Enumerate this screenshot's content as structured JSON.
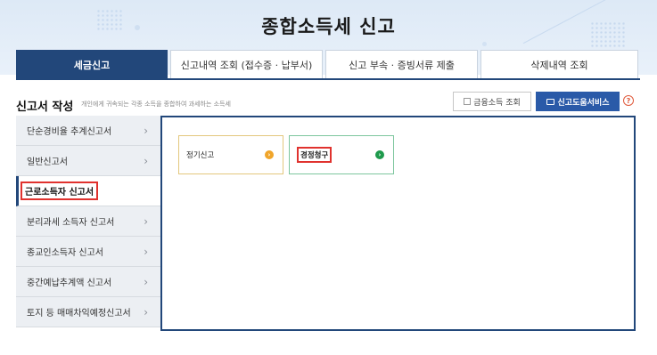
{
  "header": {
    "title": "종합소득세 신고"
  },
  "tabs": [
    {
      "label": "세금신고",
      "active": true
    },
    {
      "label": "신고내역 조회 (접수증 · 납부서)",
      "active": false
    },
    {
      "label": "신고 부속 · 증빙서류 제출",
      "active": false
    },
    {
      "label": "삭제내역 조회",
      "active": false
    }
  ],
  "section": {
    "title": "신고서 작성",
    "description": "개인에게 귀속되는 각종 소득을 종합하여 과세하는 소득세"
  },
  "actions": {
    "finance_label": "금융소득 조회",
    "help_label": "신고도움서비스",
    "help_question": "?"
  },
  "sidebar": {
    "items": [
      {
        "label": "단순경비율 추계신고서"
      },
      {
        "label": "일반신고서"
      },
      {
        "label": "근로소득자 신고서",
        "active": true
      },
      {
        "label": "분리과세 소득자 신고서"
      },
      {
        "label": "종교인소득자 신고서"
      },
      {
        "label": "중간예납추계액 신고서"
      },
      {
        "label": "토지 등 매매차익예정신고서"
      }
    ],
    "chevron": "›"
  },
  "cards": [
    {
      "label": "정기신고",
      "accent": "#f0a52a"
    },
    {
      "label": "경정청구",
      "accent": "#1e9a4c"
    }
  ],
  "colors": {
    "primary": "#22477a",
    "help_button": "#2a5aa8",
    "highlight": "#e0322e"
  }
}
